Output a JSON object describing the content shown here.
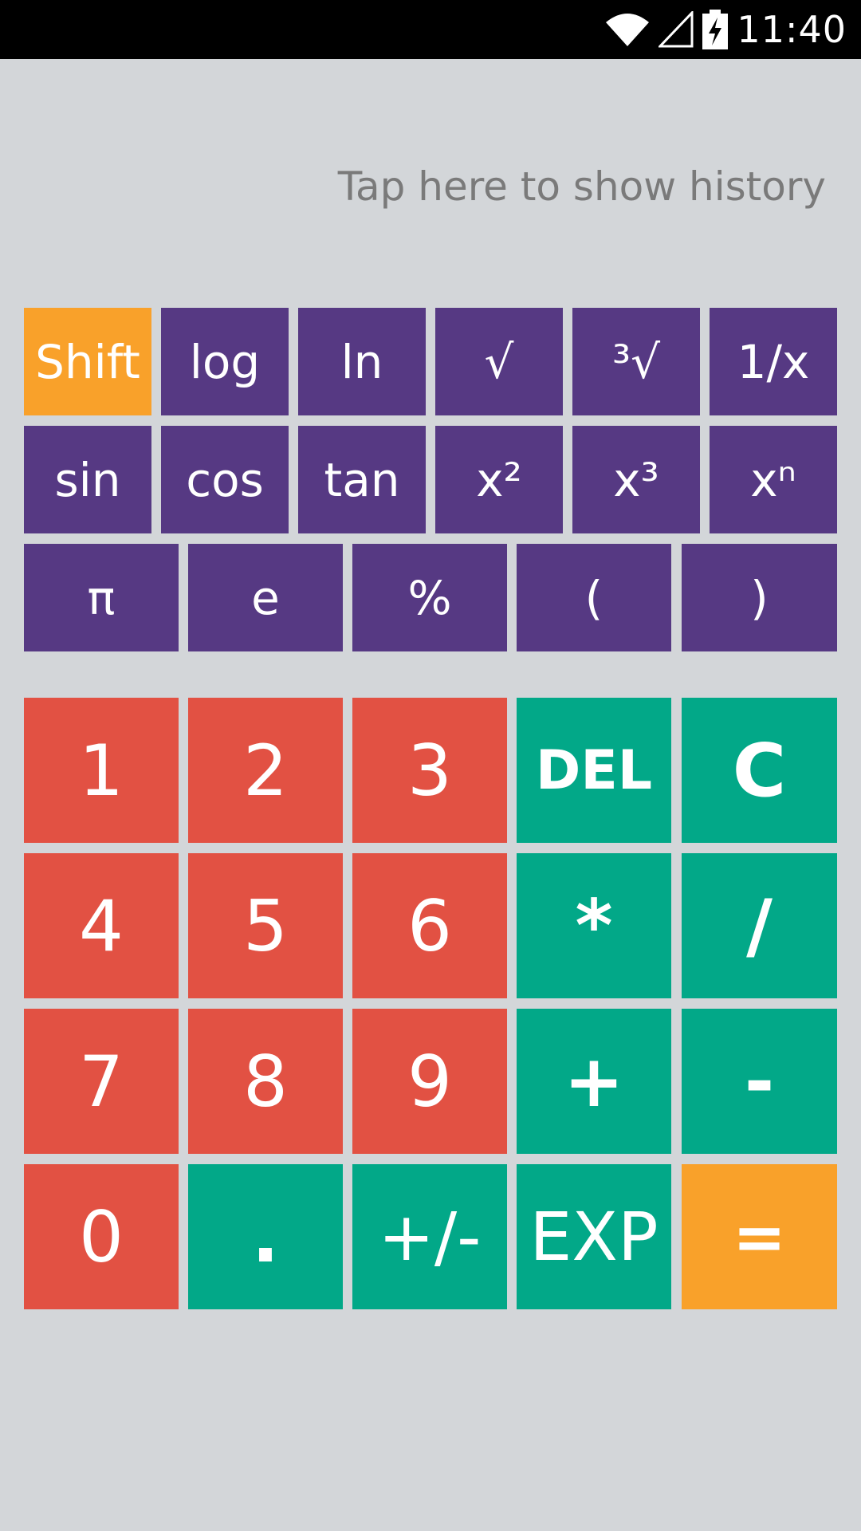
{
  "status_bar": {
    "time": "11:40",
    "icons": [
      "wifi-icon",
      "cell-signal-icon",
      "battery-charging-icon"
    ]
  },
  "display": {
    "history_hint": "Tap here to show history"
  },
  "scientific_keys": {
    "row1": [
      "Shift",
      "log",
      "ln",
      "√",
      "³√",
      "1/x"
    ],
    "row2": [
      "sin",
      "cos",
      "tan",
      "x²",
      "x³",
      "xⁿ"
    ],
    "row3": [
      "π",
      "e",
      "%",
      "(",
      ")"
    ]
  },
  "main_keys": {
    "row1": [
      "1",
      "2",
      "3",
      "DEL",
      "C"
    ],
    "row2": [
      "4",
      "5",
      "6",
      "*",
      "/"
    ],
    "row3": [
      "7",
      "8",
      "9",
      "+",
      "-"
    ],
    "row4": [
      "0",
      ".",
      "+/-",
      "EXP",
      "="
    ]
  },
  "colors": {
    "background": "#d3d6d9",
    "function_keys": "#563983",
    "shift_and_equals": "#f9a12a",
    "number_keys": "#e25143",
    "operator_keys": "#02a888"
  }
}
